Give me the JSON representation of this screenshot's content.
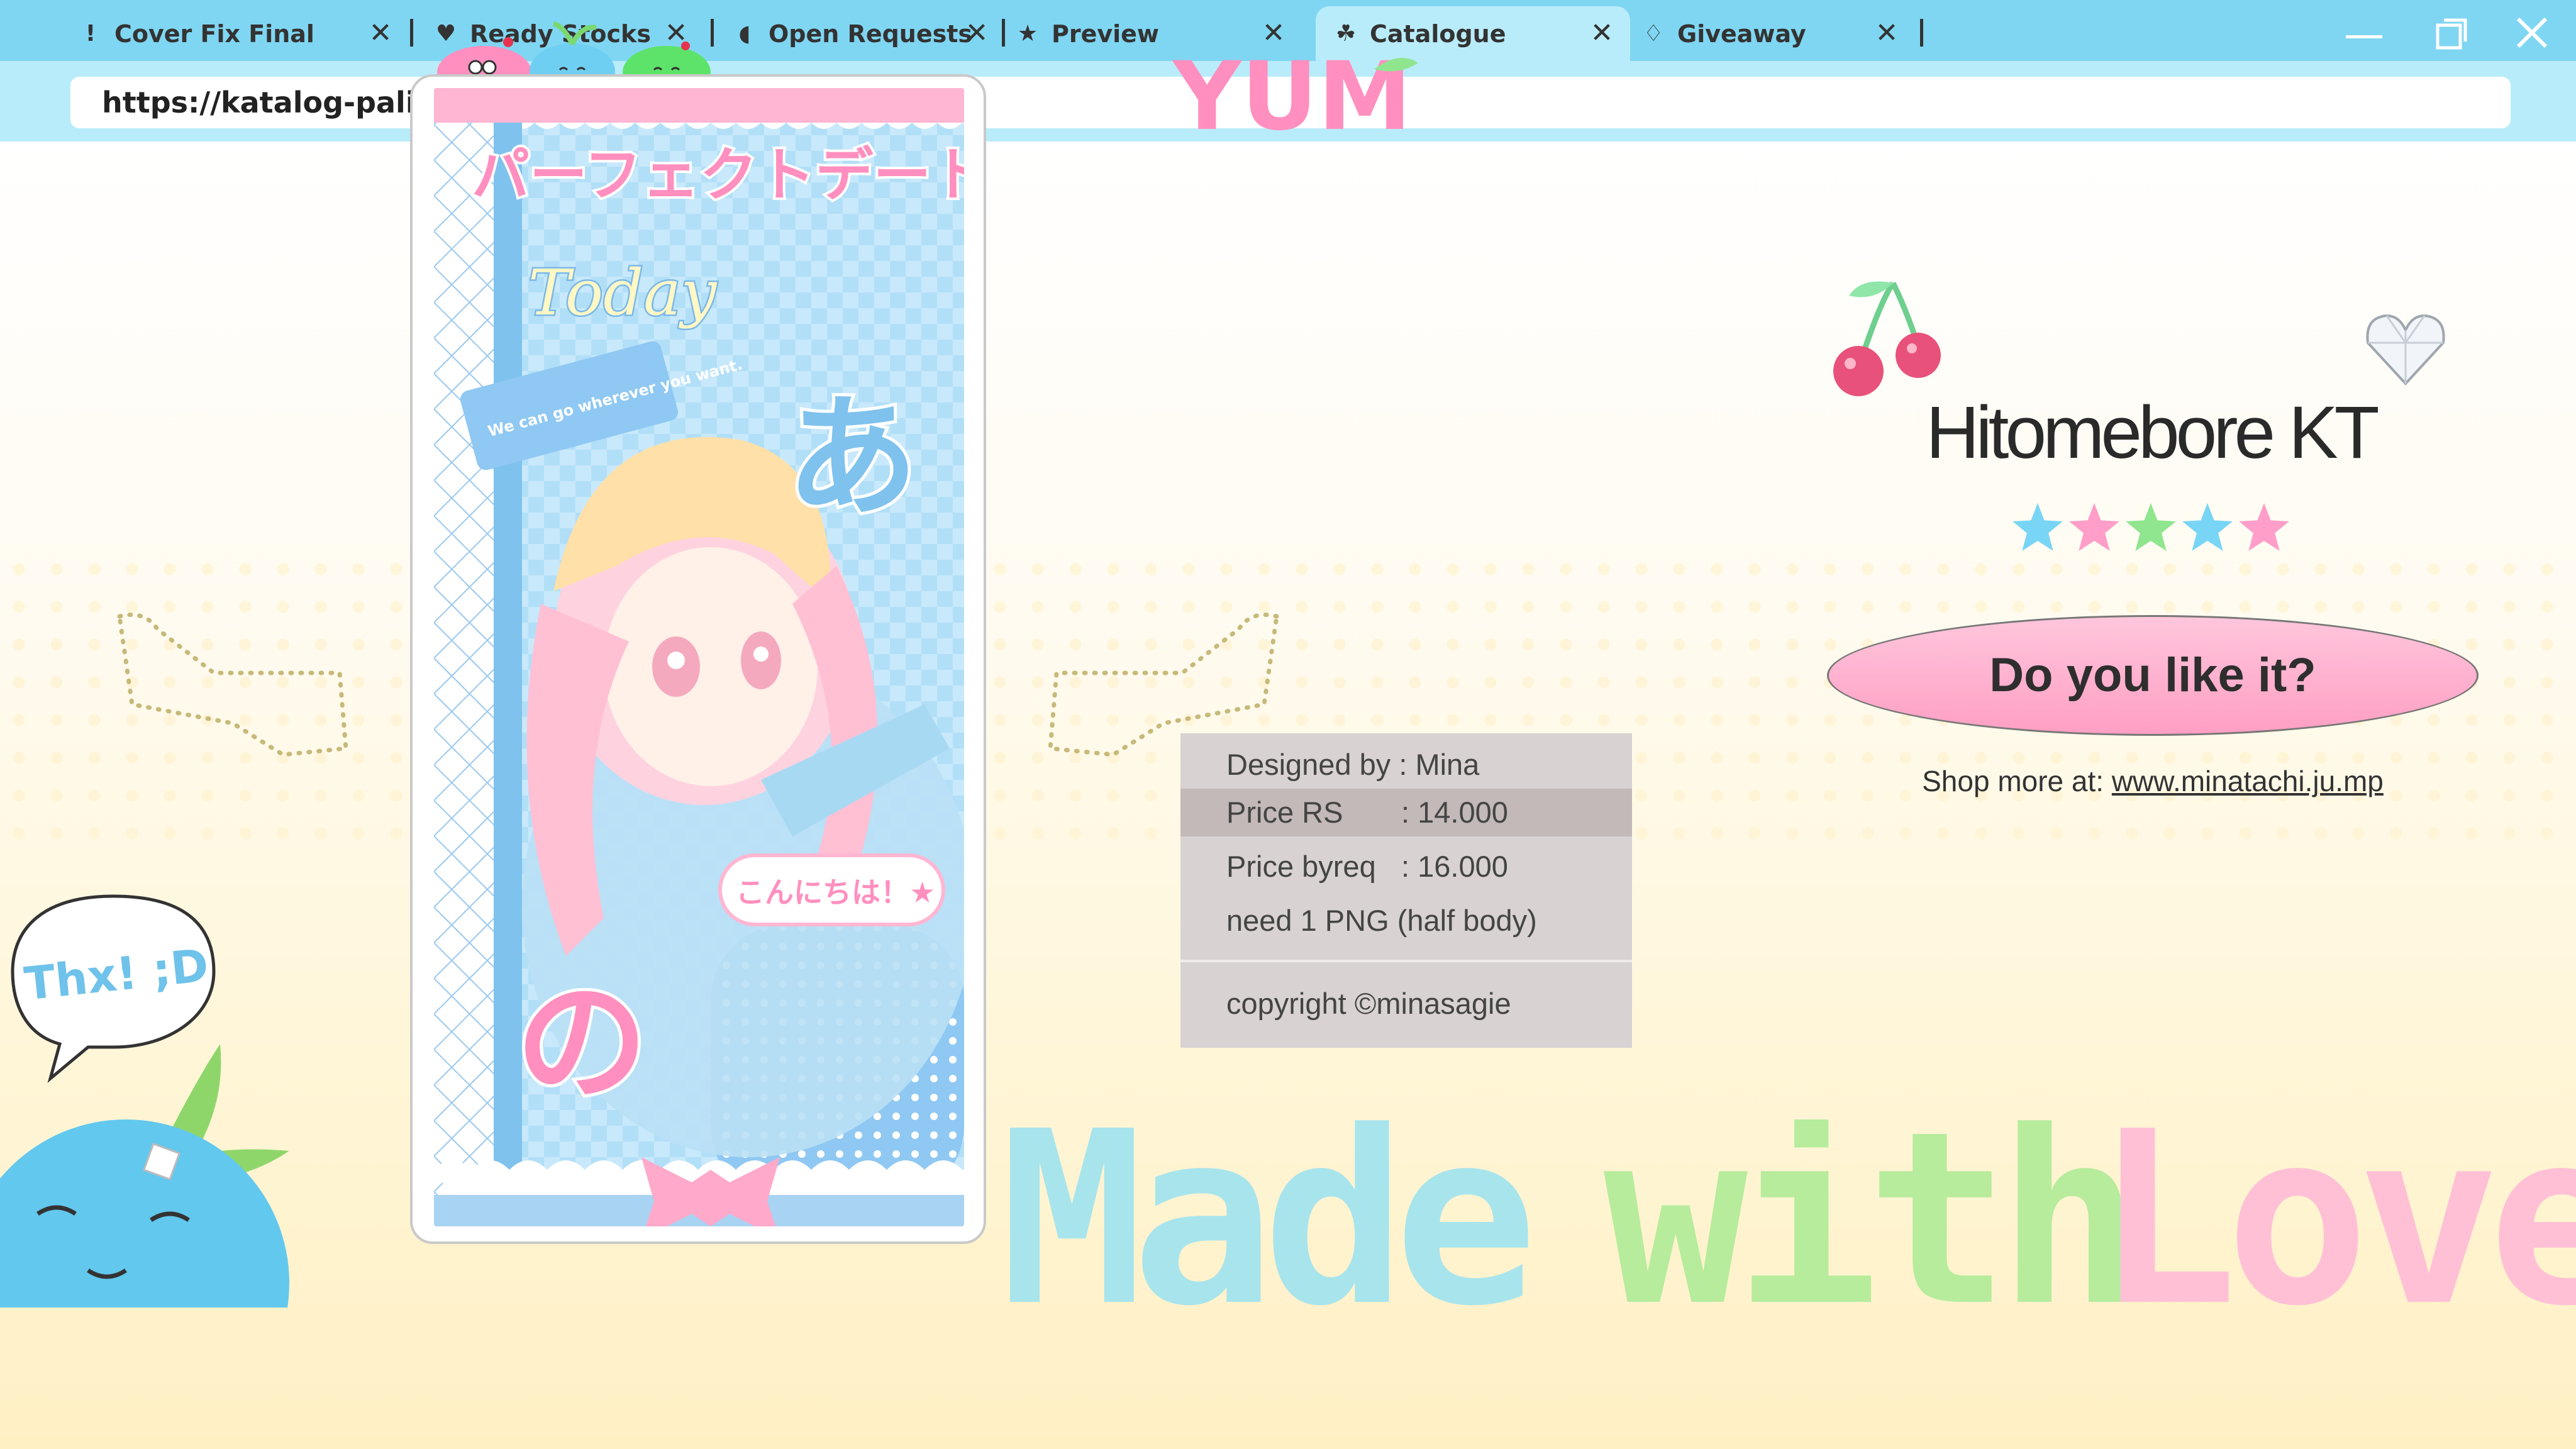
{
  "browser": {
    "tabs": [
      {
        "icon": "exclamation-icon",
        "glyph": "!",
        "label": "Cover Fix Final",
        "active": false
      },
      {
        "icon": "heart-icon",
        "glyph": "♥",
        "label": "Ready Stocks",
        "active": false
      },
      {
        "icon": "bean-icon",
        "glyph": "◖",
        "label": "Open Requests",
        "active": false
      },
      {
        "icon": "star-icon",
        "glyph": "★",
        "label": "Preview",
        "active": false
      },
      {
        "icon": "cherry-icon",
        "glyph": "☘",
        "label": "Catalogue",
        "active": true
      },
      {
        "icon": "ice-cream-icon",
        "glyph": "♢",
        "label": "Giveaway",
        "active": false
      }
    ],
    "close_glyph": "✕",
    "url": "https://katalog-paling-keren-wajib-jajan"
  },
  "product": {
    "name": "Hitomebore KT",
    "rating": 5,
    "star_colors": [
      "#79d5f5",
      "#ff9ec8",
      "#8fe68f",
      "#79d5f5",
      "#ff9ec8"
    ],
    "like_label": "Do you like it?",
    "shop_prefix": "Shop more at: ",
    "shop_link": "www.minatachi.ju.mp"
  },
  "info": {
    "designed_by": "Designed by : Mina",
    "price_rs_label": "Price RS",
    "price_rs_value": ": 14.000",
    "price_byreq_label": "Price byreq",
    "price_byreq_value": ": 16.000",
    "need": "need 1 PNG (half body)",
    "copyright": "copyright ©minasagie"
  },
  "artwork": {
    "jp_title": "パーフェクトデート",
    "today": "Today",
    "speech": "We can go wherever you want.",
    "a_char": "あ",
    "no_char": "の",
    "hello": "こんにちは！★"
  },
  "decor": {
    "yum": "YUM!",
    "thx": "Thx! ;D",
    "pixel_text": "Made with Love"
  },
  "colors": {
    "tabbar": "#7fd6f2",
    "addrbar": "#b9ecfa",
    "pink": "#ff9ec8",
    "blue": "#79d5f5",
    "green": "#8fe68f"
  }
}
